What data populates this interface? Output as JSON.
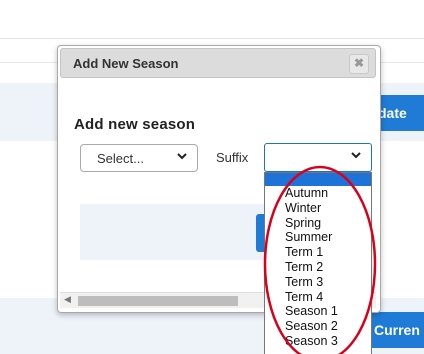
{
  "background": {
    "update_button_label": "date",
    "current_button_label": "Curren"
  },
  "dialog": {
    "title": "Add New Season",
    "close_glyph": "✖",
    "heading": "Add new season",
    "season_select": {
      "value": "Select...",
      "chevron": "⌄"
    },
    "suffix_label": "Suffix",
    "suffix_select": {
      "value": "",
      "chevron": "⌄"
    },
    "scroll_left_glyph": "◀"
  },
  "suffix_options": [
    "",
    "Autumn",
    "Winter",
    "Spring",
    "Summer",
    "Term 1",
    "Term 2",
    "Term 3",
    "Term 4",
    "Season 1",
    "Season 2",
    "Season 3"
  ],
  "colors": {
    "accent": "#1f7bd6",
    "highlight": "#1e73d8",
    "annotation": "#d9001b"
  }
}
